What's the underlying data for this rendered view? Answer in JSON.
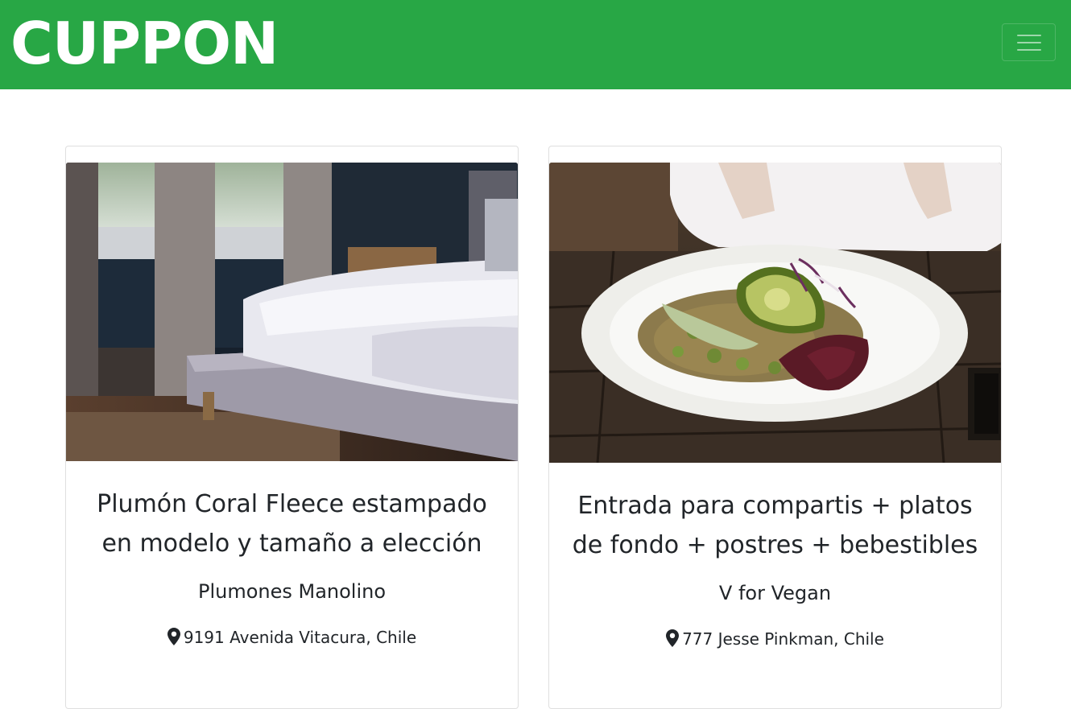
{
  "navbar": {
    "brand": "CUPPON",
    "brand_color": "#ffffff",
    "background_color": "#28a745",
    "toggler_icon": "hamburger-menu-icon"
  },
  "deals": [
    {
      "title": "Plumón Coral Fleece estampado en modelo y tamaño a elección",
      "merchant": "Plumones Manolino",
      "location": "9191 Avenida Vitacura, Chile",
      "image": "bedroom-bed-photo",
      "location_icon": "map-marker-icon"
    },
    {
      "title": "Entrada para compartis + platos de fondo + postres + bebestibles",
      "merchant": "V for Vegan",
      "location": "777 Jesse Pinkman, Chile",
      "image": "vegan-salad-bowl-photo",
      "location_icon": "map-marker-icon"
    }
  ]
}
